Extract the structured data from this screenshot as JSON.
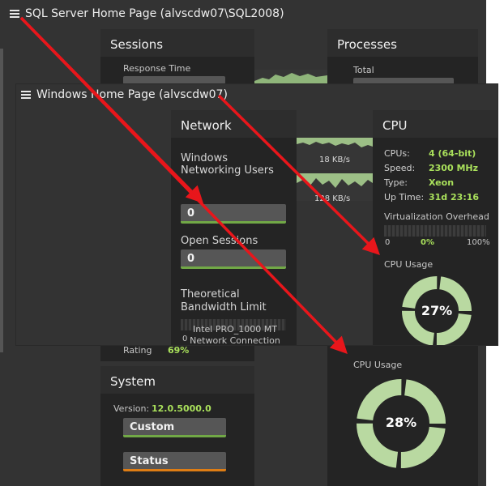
{
  "sql_window": {
    "title": "SQL Server Home Page (alvscdw07\\SQL2008)",
    "sessions": {
      "title": "Sessions",
      "response_time_label": "Response Time",
      "rating_label": "Rating",
      "rating_value": "69%"
    },
    "processes": {
      "title": "Processes",
      "total_label": "Total"
    },
    "system": {
      "title": "System",
      "version_label": "Version:",
      "version_value": "12.0.5000.0",
      "custom_label": "Custom",
      "status_label": "Status"
    },
    "cpu_usage": {
      "label": "CPU Usage",
      "value": "28%",
      "percent": 28
    }
  },
  "windows_window": {
    "title": "Windows Home Page (alvscdw07)",
    "network": {
      "title": "Network",
      "networking_users_label": "Windows Networking Users",
      "networking_users_value": "0",
      "open_sessions_label": "Open Sessions",
      "open_sessions_value": "0",
      "bandwidth_label": "Theoretical Bandwidth Limit",
      "bandwidth_axis_min": "0",
      "adapter_name": "Intel PRO_1000 MT Network Connection",
      "speed_1": "18 KB/s",
      "speed_2": "128 KB/s"
    },
    "cpu": {
      "title": "CPU",
      "cpus_label": "CPUs:",
      "cpus_value": "4 (64-bit)",
      "speed_label": "Speed:",
      "speed_value": "2300 MHz",
      "type_label": "Type:",
      "type_value": "Xeon",
      "uptime_label": "Up Time:",
      "uptime_value": "31d 23:16",
      "virt_label": "Virtualization Overhead",
      "virt_min": "0",
      "virt_value": "0%",
      "virt_max": "100%",
      "usage_label": "CPU Usage",
      "usage_value": "27%",
      "usage_percent": 27
    }
  },
  "colors": {
    "background": "#333333",
    "tile": "#242424",
    "accent_green": "#a9e05b",
    "bar_green": "#71a846",
    "bar_orange": "#de7d14",
    "arrow_red": "#e8161b"
  }
}
